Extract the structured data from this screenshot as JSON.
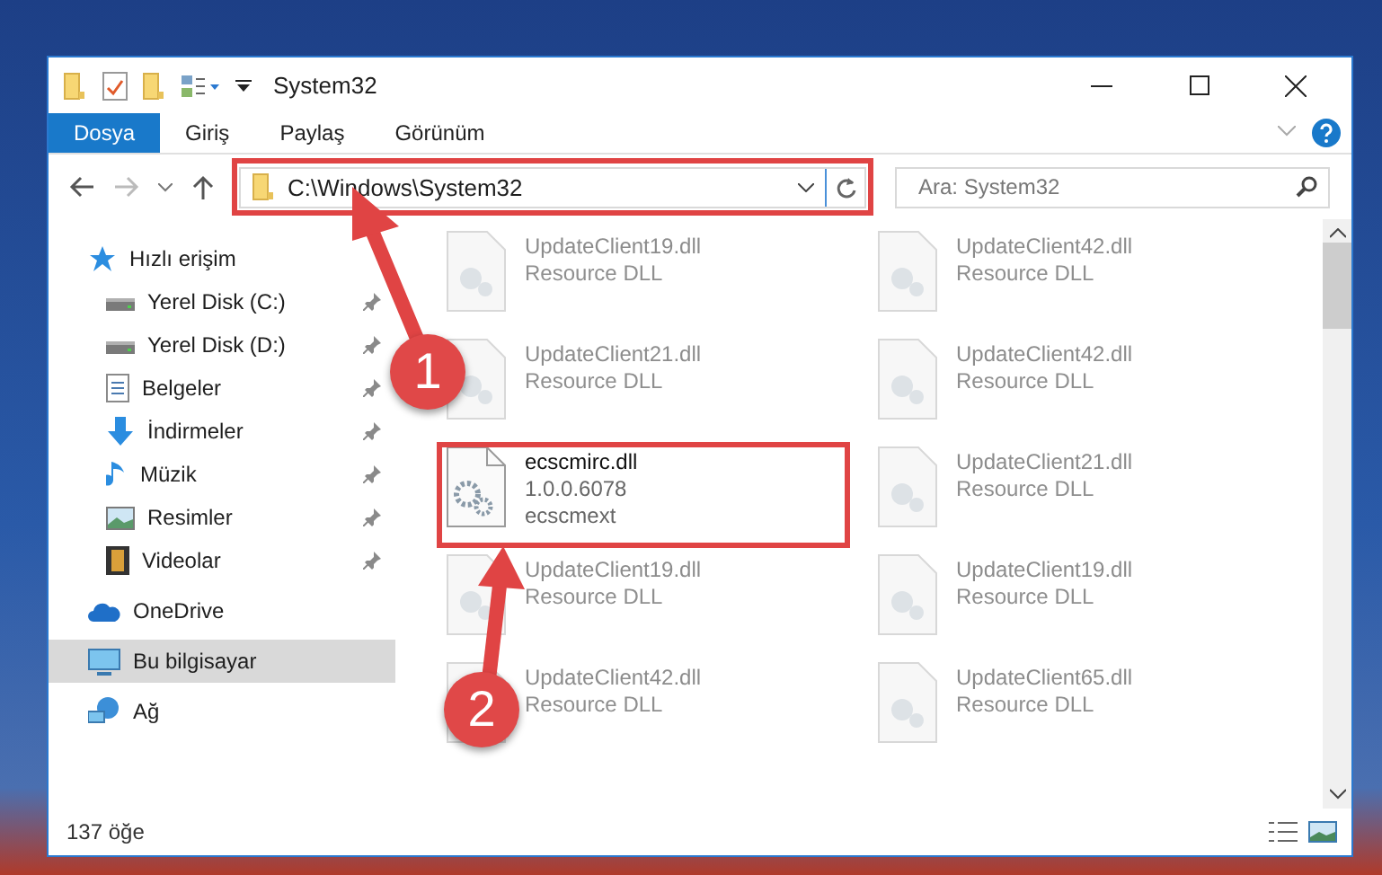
{
  "window": {
    "title": "System32"
  },
  "ribbon_tabs": [
    {
      "label": "Dosya",
      "selected": true
    },
    {
      "label": "Giriş",
      "selected": false
    },
    {
      "label": "Paylaş",
      "selected": false
    },
    {
      "label": "Görünüm",
      "selected": false
    }
  ],
  "address_bar": {
    "path": "C:\\Windows\\System32"
  },
  "search": {
    "placeholder": "Ara: System32"
  },
  "sidebar": {
    "items": [
      {
        "label": "Hızlı erişim",
        "kind": "quick",
        "selected": false,
        "children": [
          {
            "label": "Yerel Disk (C:)",
            "kind": "disk",
            "pinned": true,
            "selected": false
          },
          {
            "label": "Yerel Disk (D:)",
            "kind": "disk",
            "pinned": true,
            "selected": false
          },
          {
            "label": "Belgeler",
            "kind": "docs",
            "pinned": true,
            "selected": false
          },
          {
            "label": "İndirmeler",
            "kind": "downloads",
            "pinned": true,
            "selected": false
          },
          {
            "label": "Müzik",
            "kind": "music",
            "pinned": true,
            "selected": false
          },
          {
            "label": "Resimler",
            "kind": "pictures",
            "pinned": true,
            "selected": false
          },
          {
            "label": "Videolar",
            "kind": "videos",
            "pinned": true,
            "selected": false
          }
        ]
      },
      {
        "label": "OneDrive",
        "kind": "cloud",
        "selected": false
      },
      {
        "label": "Bu bilgisayar",
        "kind": "pc",
        "selected": true
      },
      {
        "label": "Ağ",
        "kind": "network",
        "selected": false
      }
    ]
  },
  "files": [
    {
      "name": "UpdateClient19.dll",
      "detail": "Resource DLL",
      "blurred": true
    },
    {
      "name": "UpdateClient42.dll",
      "detail": "Resource DLL",
      "blurred": true
    },
    {
      "name": "UpdateClient21.dll",
      "detail": "Resource DLL",
      "blurred": true
    },
    {
      "name": "UpdateClient42.dll",
      "detail": "Resource DLL",
      "blurred": true
    },
    {
      "name": "ecscmirc.dll",
      "version": "1.0.0.6078",
      "detail": "ecscmext",
      "blurred": false
    },
    {
      "name": "UpdateClient21.dll",
      "detail": "Resource DLL",
      "blurred": true
    },
    {
      "name": "UpdateClient19.dll",
      "detail": "Resource DLL",
      "blurred": true
    },
    {
      "name": "UpdateClient19.dll",
      "detail": "Resource DLL",
      "blurred": true
    },
    {
      "name": "UpdateClient42.dll",
      "detail": "Resource DLL",
      "blurred": true
    },
    {
      "name": "UpdateClient65.dll",
      "detail": "Resource DLL",
      "blurred": true
    }
  ],
  "status_bar": {
    "count": "137 öğe"
  },
  "annotations": [
    {
      "label": "1"
    },
    {
      "label": "2"
    }
  ]
}
